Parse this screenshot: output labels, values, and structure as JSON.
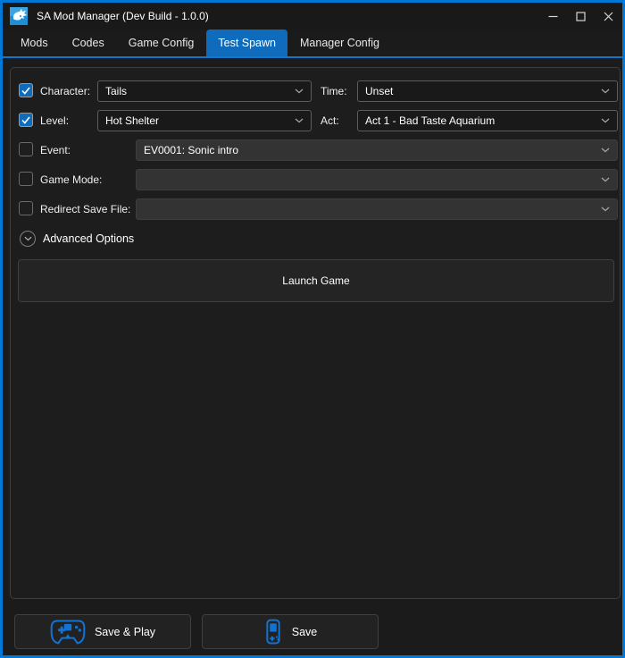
{
  "titlebar": {
    "title": "SA Mod Manager (Dev Build - 1.0.0)"
  },
  "tabs": {
    "items": [
      {
        "label": "Mods",
        "active": false
      },
      {
        "label": "Codes",
        "active": false
      },
      {
        "label": "Game Config",
        "active": false
      },
      {
        "label": "Test Spawn",
        "active": true
      },
      {
        "label": "Manager Config",
        "active": false
      }
    ]
  },
  "form": {
    "character": {
      "label": "Character:",
      "value": "Tails",
      "checked": true
    },
    "time": {
      "label": "Time:",
      "value": "Unset"
    },
    "level": {
      "label": "Level:",
      "value": "Hot Shelter",
      "checked": true
    },
    "act": {
      "label": "Act:",
      "value": "Act 1 - Bad Taste Aquarium"
    },
    "event": {
      "label": "Event:",
      "value": "EV0001: Sonic intro",
      "checked": false
    },
    "game_mode": {
      "label": "Game Mode:",
      "value": "",
      "checked": false
    },
    "redirect_save_file": {
      "label": "Redirect Save File:",
      "value": "",
      "checked": false
    },
    "advanced_options_label": "Advanced Options",
    "launch_game_label": "Launch Game"
  },
  "footer": {
    "save_and_play_label": "Save & Play",
    "save_label": "Save"
  },
  "colors": {
    "accent_blue": "#0f6cbd",
    "window_border_blue": "#0078d7",
    "icon_blue": "#1273d2"
  }
}
